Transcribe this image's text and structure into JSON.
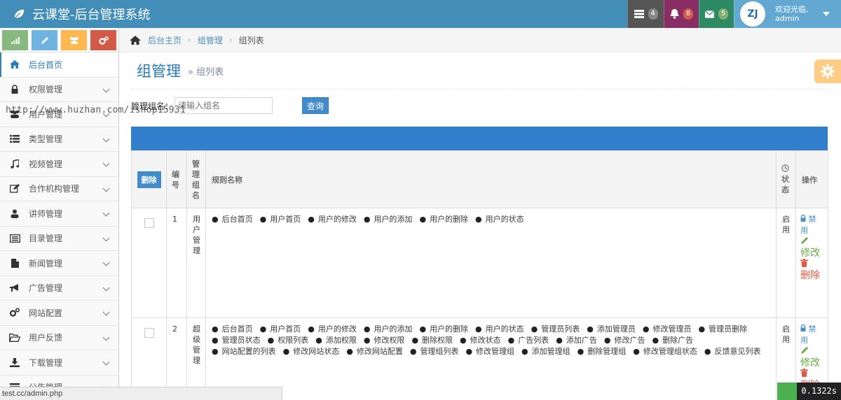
{
  "app": {
    "title": "云课堂-后台管理系统"
  },
  "nav": {
    "tasks_badge": "4",
    "notifications_badge": "8",
    "messages_badge": "5",
    "user": {
      "avatar": "ZJ",
      "welcome": "欢迎光临,",
      "name": "admin"
    }
  },
  "sidebar": {
    "items": [
      {
        "label": "后台首页",
        "icon": "home-icon"
      },
      {
        "label": "权限管理",
        "icon": "lock-icon"
      },
      {
        "label": "用户管理",
        "icon": "users-icon"
      },
      {
        "label": "类型管理",
        "icon": "list-icon"
      },
      {
        "label": "视频管理",
        "icon": "music-icon"
      },
      {
        "label": "合作机构管理",
        "icon": "edit-icon"
      },
      {
        "label": "讲师管理",
        "icon": "user-icon"
      },
      {
        "label": "目录管理",
        "icon": "list-alt-icon"
      },
      {
        "label": "新闻管理",
        "icon": "file-icon"
      },
      {
        "label": "广告管理",
        "icon": "bullhorn-icon"
      },
      {
        "label": "网站配置",
        "icon": "cogs-icon"
      },
      {
        "label": "用户反馈",
        "icon": "folder-open-icon"
      },
      {
        "label": "下载管理",
        "icon": "download-icon"
      },
      {
        "label": "公告管理",
        "icon": "list-icon"
      }
    ]
  },
  "breadcrumb": {
    "home": "后台主页",
    "section": "组管理",
    "current": "组列表"
  },
  "page": {
    "title": "组管理",
    "subtitle": "» 组列表"
  },
  "search": {
    "label": "管理组名：",
    "placeholder": "请输入组名",
    "button": "查询"
  },
  "watermark": "http://www.huzhan.com/ishop15931",
  "table": {
    "delete_button": "删除",
    "headers": {
      "id": "编号",
      "group": "管理组名",
      "rules": "规则名称",
      "status": "状态",
      "ops": "操作"
    },
    "rows": [
      {
        "id": "1",
        "group": "用户管理",
        "rules": [
          "后台首页",
          "用户首页",
          "用户的修改",
          "用户的添加",
          "用户的删除",
          "用户的状态"
        ],
        "status": "启用",
        "ops": {
          "disable": "禁用",
          "edit": "修改",
          "delete": "删除"
        }
      },
      {
        "id": "2",
        "group": "超级管理",
        "rules": [
          "后台首页",
          "用户首页",
          "用户的修改",
          "用户的添加",
          "用户的删除",
          "用户的状态",
          "管理员列表",
          "添加管理员",
          "修改管理员",
          "管理员删除",
          "管理员状态",
          "权限列表",
          "添加权限",
          "修改权限",
          "删除权限",
          "修改状态",
          "广告列表",
          "添加广告",
          "修改广告",
          "删除广告",
          "网站配置的列表",
          "修改网站状态",
          "修改网站配置",
          "管理组列表",
          "修改管理组",
          "添加管理组",
          "删除管理组",
          "修改管理组状态",
          "反馈意见列表"
        ],
        "status": "启用",
        "ops": {
          "disable": "禁用",
          "edit": "修改",
          "delete": "删除"
        }
      }
    ]
  },
  "statusbar": {
    "url": "test.cc/admin.php"
  },
  "timer": {
    "value": "0.1322s"
  },
  "colors": {
    "navbar": "#438eb9",
    "accent": "#307ecc",
    "link": "#4c8fbd"
  }
}
